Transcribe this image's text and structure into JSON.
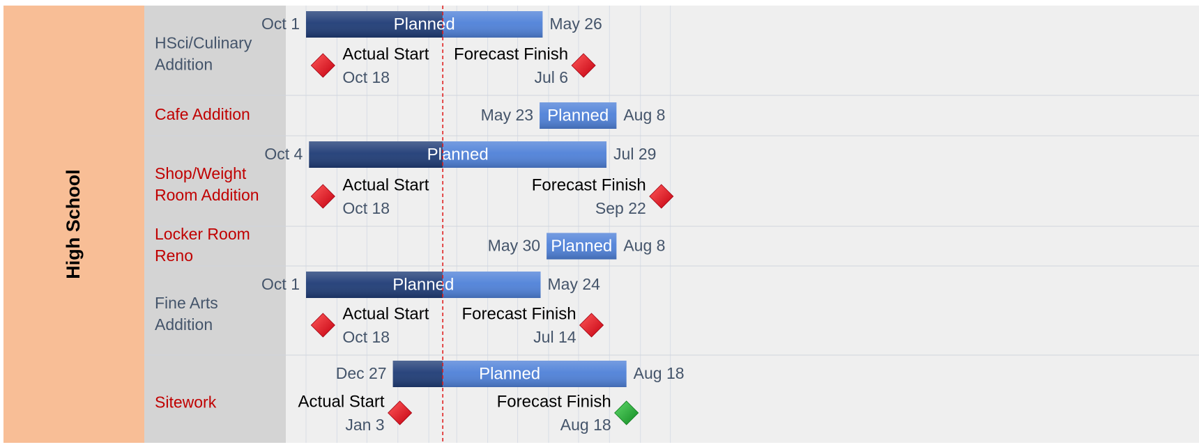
{
  "colors": {
    "group_band": "#f8be96",
    "label_panel": "#d4d4d4",
    "chart_bg": "#efefef",
    "row_label_dark": "#44546a",
    "row_label_red": "#c00000",
    "bar_dark": "#1f3c76",
    "bar_light": "#4f81d8",
    "milestone_red": "#e8101a",
    "milestone_green": "#22aa35",
    "today_line": "#e02020",
    "gridline": "#d8dde6"
  },
  "chart_data": {
    "type": "gantt",
    "group": "High School",
    "today_marker": "2023-02-15",
    "x_range": [
      "2022-09-20",
      "2023-10-15"
    ],
    "rows": [
      {
        "label_lines": [
          "HSci/Culinary",
          "Addition"
        ],
        "label_color": "dark",
        "bar": {
          "label": "Planned",
          "start": "2022-10-01",
          "end": "2023-05-26",
          "start_text": "Oct 1",
          "end_text": "May 26"
        },
        "milestones": [
          {
            "title": "Actual Start",
            "date": "2022-10-18",
            "date_text": "Oct 18",
            "color": "red",
            "text_side": "right"
          },
          {
            "title": "Forecast Finish",
            "date": "2023-07-06",
            "date_text": "Jul 6",
            "color": "red",
            "text_side": "left"
          }
        ]
      },
      {
        "label_lines": [
          "Cafe Addition"
        ],
        "label_color": "red",
        "bar": {
          "label": "Planned",
          "start": "2023-05-23",
          "end": "2023-08-08",
          "start_text": "May 23",
          "end_text": "Aug 8"
        },
        "milestones": []
      },
      {
        "label_lines": [
          "Shop/Weight",
          "Room Addition"
        ],
        "label_color": "red",
        "bar": {
          "label": "Planned",
          "start": "2022-10-04",
          "end": "2023-07-29",
          "start_text": "Oct 4",
          "end_text": "Jul 29"
        },
        "milestones": [
          {
            "title": "Actual Start",
            "date": "2022-10-18",
            "date_text": "Oct 18",
            "color": "red",
            "text_side": "right"
          },
          {
            "title": "Forecast Finish",
            "date": "2023-09-22",
            "date_text": "Sep 22",
            "color": "red",
            "text_side": "left"
          }
        ]
      },
      {
        "label_lines": [
          "Locker Room",
          "Reno"
        ],
        "label_color": "red",
        "bar": {
          "label": "Planned",
          "start": "2023-05-30",
          "end": "2023-08-08",
          "start_text": "May 30",
          "end_text": "Aug 8"
        },
        "milestones": []
      },
      {
        "label_lines": [
          "Fine Arts",
          "Addition"
        ],
        "label_color": "dark",
        "bar": {
          "label": "Planned",
          "start": "2022-10-01",
          "end": "2023-05-24",
          "start_text": "Oct 1",
          "end_text": "May 24"
        },
        "milestones": [
          {
            "title": "Actual Start",
            "date": "2022-10-18",
            "date_text": "Oct 18",
            "color": "red",
            "text_side": "right"
          },
          {
            "title": "Forecast Finish",
            "date": "2023-07-14",
            "date_text": "Jul 14",
            "color": "red",
            "text_side": "left"
          }
        ]
      },
      {
        "label_lines": [
          "Sitework"
        ],
        "label_color": "red",
        "bar": {
          "label": "Planned",
          "start": "2022-12-27",
          "end": "2023-08-18",
          "start_text": "Dec 27",
          "end_text": "Aug 18"
        },
        "milestones": [
          {
            "title": "Actual Start",
            "date": "2023-01-03",
            "date_text": "Jan 3",
            "color": "red",
            "text_side": "left"
          },
          {
            "title": "Forecast Finish",
            "date": "2023-08-18",
            "date_text": "Aug 18",
            "color": "green",
            "text_side": "left"
          }
        ]
      }
    ]
  }
}
